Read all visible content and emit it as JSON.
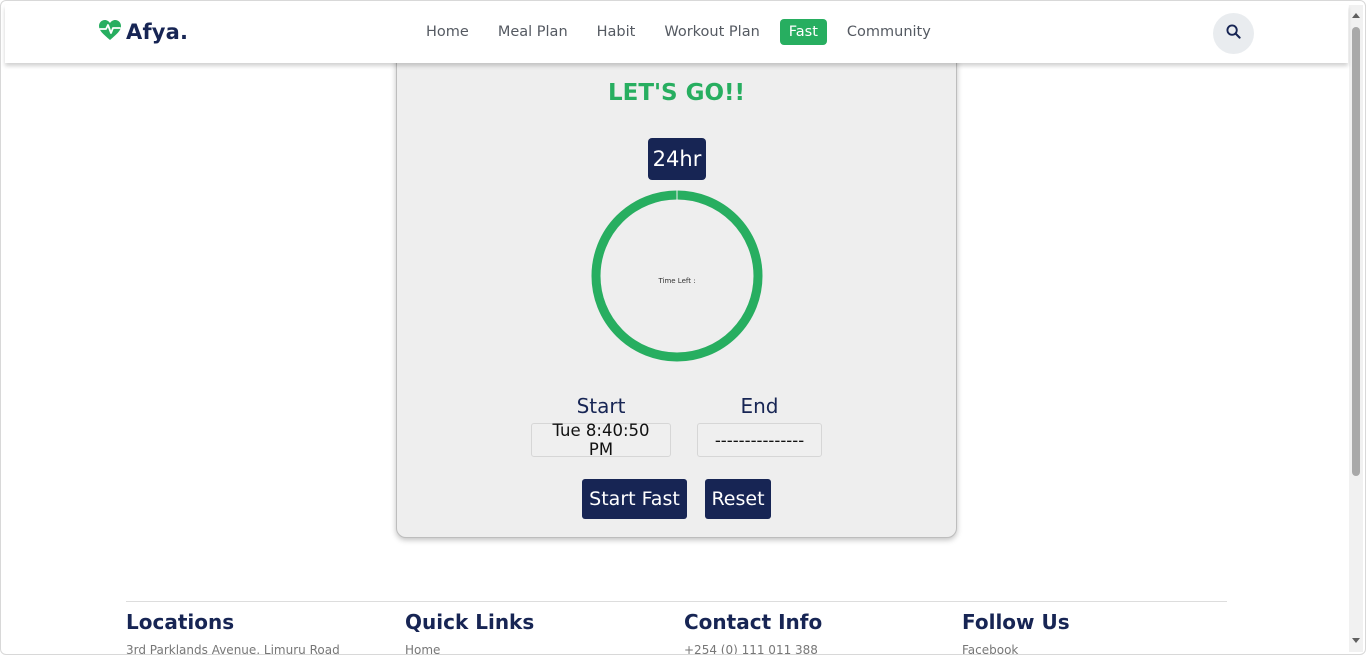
{
  "brand": {
    "name": "Afya.",
    "icon": "heart-pulse-icon",
    "accent_color": "#27ae60",
    "navy_color": "#172554"
  },
  "nav": {
    "items": [
      {
        "label": "Home",
        "active": false
      },
      {
        "label": "Meal Plan",
        "active": false
      },
      {
        "label": "Habit",
        "active": false
      },
      {
        "label": "Workout Plan",
        "active": false
      },
      {
        "label": "Fast",
        "active": true
      },
      {
        "label": "Community",
        "active": false
      }
    ],
    "search_icon": "search-icon"
  },
  "fast": {
    "headline": "LET'S GO!!",
    "duration_label": "24hr",
    "progress_fraction": 1.0,
    "time_left_label": "Time Left :",
    "start_label": "Start",
    "start_value": "Tue 8:40:50 PM",
    "end_label": "End",
    "end_value": "---------------",
    "start_button": "Start Fast",
    "reset_button": "Reset"
  },
  "footer": {
    "columns": [
      {
        "heading": "Locations",
        "first_line": "3rd Parklands Avenue, Limuru Road"
      },
      {
        "heading": "Quick Links",
        "first_line": "Home"
      },
      {
        "heading": "Contact Info",
        "first_line": "+254 (0) 111 011 388"
      },
      {
        "heading": "Follow Us",
        "first_line": "Facebook"
      }
    ]
  }
}
